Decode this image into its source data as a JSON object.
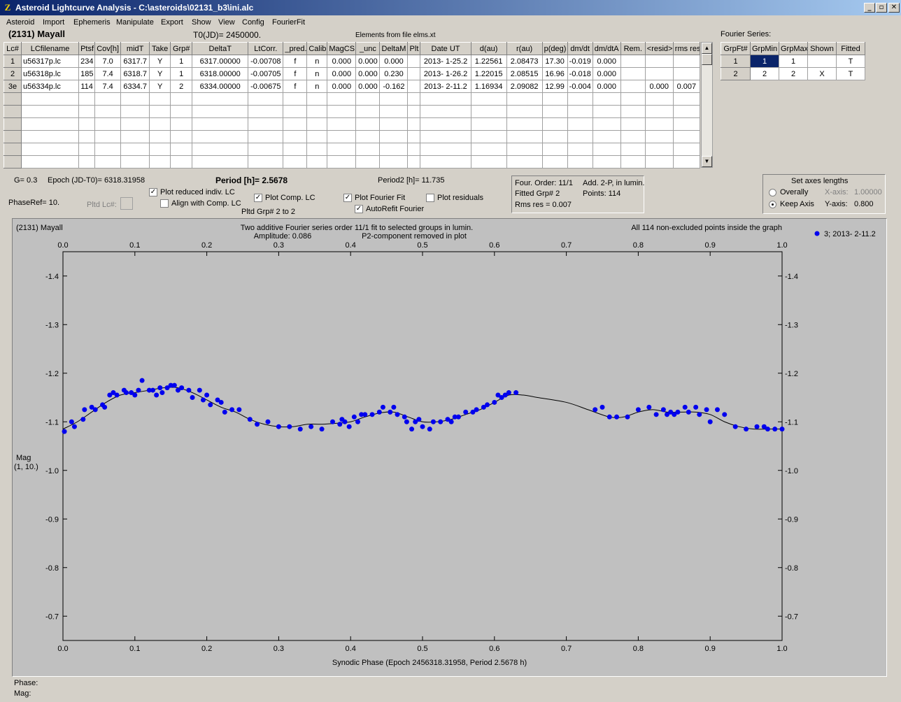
{
  "window": {
    "title": "Asteroid Lightcurve Analysis - C:\\asteroids\\02131_b3\\ini.alc",
    "min": "_",
    "max": "▫",
    "close": "✕"
  },
  "menu": [
    "Asteroid",
    "Import",
    "Ephemeris",
    "Manipulate",
    "Export",
    "Show",
    "View",
    "Config",
    "FourierFit"
  ],
  "header": {
    "asteroid": "(2131) Mayall",
    "t0": "T0(JD)= 2450000.",
    "elements": "Elements from file elms.xt"
  },
  "lc_table": {
    "columns": [
      "Lc#",
      "LCfilename",
      "Ptsf",
      "Cov[h]",
      "midT",
      "Take",
      "Grp#",
      "DeltaT",
      "LtCorr.",
      "_pred.",
      "Calib.",
      "MagCS",
      "_unc",
      "DeltaM",
      "Plt",
      "Date UT",
      "d(au)",
      "r(au)",
      "p(deg)",
      "dm/dt",
      "dm/dtA",
      "Rem.",
      "<resid>",
      "rms res"
    ],
    "rows": [
      [
        "1",
        "u56317p.lc",
        "234",
        "7.0",
        "6317.7",
        "Y",
        "1",
        "6317.00000",
        "-0.00708",
        "f",
        "n",
        "0.000",
        "0.000",
        "0.000",
        "",
        "2013- 1-25.2",
        "1.22561",
        "2.08473",
        "17.30",
        "-0.019",
        "0.000",
        "",
        "",
        ""
      ],
      [
        "2",
        "u56318p.lc",
        "185",
        "7.4",
        "6318.7",
        "Y",
        "1",
        "6318.00000",
        "-0.00705",
        "f",
        "n",
        "0.000",
        "0.000",
        "0.230",
        "",
        "2013- 1-26.2",
        "1.22015",
        "2.08515",
        "16.96",
        "-0.018",
        "0.000",
        "",
        "",
        ""
      ],
      [
        "3e",
        "u56334p.lc",
        "114",
        "7.4",
        "6334.7",
        "Y",
        "2",
        "6334.00000",
        "-0.00675",
        "f",
        "n",
        "0.000",
        "0.000",
        "-0.162",
        "",
        "2013- 2-11.2",
        "1.16934",
        "2.09082",
        "12.99",
        "-0.004",
        "0.000",
        "",
        "0.000",
        "0.007"
      ]
    ]
  },
  "fourier_series": {
    "label": "Fourier Series:",
    "columns": [
      "GrpFt#",
      "GrpMin",
      "GrpMax",
      "Shown",
      "Fitted"
    ],
    "rows": [
      [
        "1",
        "1",
        "1",
        "",
        "T"
      ],
      [
        "2",
        "2",
        "2",
        "X",
        "T"
      ]
    ]
  },
  "params": {
    "g": "G= 0.3",
    "epoch": "Epoch (JD-T0)= 6318.31958",
    "period": "Period [h]= 2.5678",
    "period2": "Period2 [h]= 11.735",
    "phaseref": "PhaseRef= 10.",
    "pltd_lc": "Pltd Lc#:",
    "pltd_grp": "Pltd Grp#  2   to   2"
  },
  "checks": {
    "plot_reduced": "Plot reduced indiv. LC",
    "align_comp": "Align with Comp. LC",
    "plot_comp": "Plot Comp. LC",
    "plot_fourier": "Plot Fourier Fit",
    "autorefit": "AutoRefit Fourier",
    "plot_residuals": "Plot residuals",
    "check": "✓"
  },
  "fourier_info": {
    "order": "Four. Order: 11/1",
    "add": "Add. 2-P, in lumin.",
    "fitted": "Fitted Grp# 2",
    "points": "Points: 114",
    "rms": "Rms res    = 0.007"
  },
  "axes_box": {
    "title": "Set axes lengths",
    "overally": "Overally",
    "keep": "Keep Axis",
    "xaxis": "X-axis:",
    "xval": "1.00000",
    "yaxis": "Y-axis:",
    "yval": "0.800"
  },
  "status": {
    "phase": "Phase:",
    "mag": "Mag:"
  },
  "chart_data": {
    "type": "scatter",
    "object": "(2131) Mayall",
    "title": "Two additive Fourier series order 11/1 fit to selected groups in lumin.",
    "subtitle": "Amplitude: 0.086",
    "note": "P2-component removed in plot",
    "info": "All 114 non-excluded points inside the graph",
    "legend": "3; 2013- 2-11.2",
    "xlabel": "Synodic Phase (Epoch 2456318.31958, Period 2.5678 h)",
    "ylabel": [
      "Mag",
      "(1, 10.)"
    ],
    "xlim": [
      0,
      1
    ],
    "ylim": [
      -0.65,
      -1.45
    ],
    "xticks": [
      "0.0",
      "0.1",
      "0.2",
      "0.3",
      "0.4",
      "0.5",
      "0.6",
      "0.7",
      "0.8",
      "0.9",
      "1.0"
    ],
    "yticks": [
      "-1.4",
      "-1.3",
      "-1.2",
      "-1.1",
      "-1.0",
      "-0.9",
      "-0.8",
      "-0.7"
    ],
    "point_color": "#0000ee",
    "points": [
      [
        0.002,
        -1.08
      ],
      [
        0.012,
        -1.1
      ],
      [
        0.016,
        -1.09
      ],
      [
        0.028,
        -1.105
      ],
      [
        0.03,
        -1.125
      ],
      [
        0.04,
        -1.13
      ],
      [
        0.045,
        -1.125
      ],
      [
        0.055,
        -1.135
      ],
      [
        0.058,
        -1.13
      ],
      [
        0.065,
        -1.155
      ],
      [
        0.07,
        -1.16
      ],
      [
        0.075,
        -1.155
      ],
      [
        0.085,
        -1.165
      ],
      [
        0.088,
        -1.16
      ],
      [
        0.095,
        -1.16
      ],
      [
        0.1,
        -1.155
      ],
      [
        0.105,
        -1.165
      ],
      [
        0.11,
        -1.185
      ],
      [
        0.12,
        -1.165
      ],
      [
        0.125,
        -1.165
      ],
      [
        0.13,
        -1.155
      ],
      [
        0.135,
        -1.17
      ],
      [
        0.138,
        -1.16
      ],
      [
        0.145,
        -1.17
      ],
      [
        0.15,
        -1.175
      ],
      [
        0.155,
        -1.175
      ],
      [
        0.16,
        -1.165
      ],
      [
        0.165,
        -1.17
      ],
      [
        0.175,
        -1.165
      ],
      [
        0.18,
        -1.15
      ],
      [
        0.19,
        -1.165
      ],
      [
        0.195,
        -1.145
      ],
      [
        0.2,
        -1.155
      ],
      [
        0.205,
        -1.135
      ],
      [
        0.215,
        -1.145
      ],
      [
        0.22,
        -1.14
      ],
      [
        0.225,
        -1.12
      ],
      [
        0.235,
        -1.125
      ],
      [
        0.245,
        -1.125
      ],
      [
        0.26,
        -1.105
      ],
      [
        0.27,
        -1.095
      ],
      [
        0.285,
        -1.1
      ],
      [
        0.3,
        -1.09
      ],
      [
        0.315,
        -1.09
      ],
      [
        0.33,
        -1.085
      ],
      [
        0.345,
        -1.09
      ],
      [
        0.36,
        -1.085
      ],
      [
        0.375,
        -1.1
      ],
      [
        0.385,
        -1.095
      ],
      [
        0.388,
        -1.105
      ],
      [
        0.392,
        -1.1
      ],
      [
        0.398,
        -1.09
      ],
      [
        0.405,
        -1.11
      ],
      [
        0.41,
        -1.1
      ],
      [
        0.415,
        -1.115
      ],
      [
        0.42,
        -1.115
      ],
      [
        0.43,
        -1.115
      ],
      [
        0.44,
        -1.12
      ],
      [
        0.445,
        -1.13
      ],
      [
        0.455,
        -1.12
      ],
      [
        0.46,
        -1.13
      ],
      [
        0.465,
        -1.115
      ],
      [
        0.475,
        -1.11
      ],
      [
        0.478,
        -1.1
      ],
      [
        0.485,
        -1.085
      ],
      [
        0.49,
        -1.1
      ],
      [
        0.495,
        -1.105
      ],
      [
        0.5,
        -1.09
      ],
      [
        0.51,
        -1.085
      ],
      [
        0.515,
        -1.1
      ],
      [
        0.525,
        -1.1
      ],
      [
        0.535,
        -1.105
      ],
      [
        0.54,
        -1.1
      ],
      [
        0.545,
        -1.11
      ],
      [
        0.55,
        -1.11
      ],
      [
        0.56,
        -1.12
      ],
      [
        0.57,
        -1.12
      ],
      [
        0.575,
        -1.125
      ],
      [
        0.585,
        -1.13
      ],
      [
        0.59,
        -1.135
      ],
      [
        0.6,
        -1.14
      ],
      [
        0.605,
        -1.155
      ],
      [
        0.61,
        -1.15
      ],
      [
        0.615,
        -1.155
      ],
      [
        0.62,
        -1.16
      ],
      [
        0.63,
        -1.16
      ],
      [
        0.74,
        -1.125
      ],
      [
        0.75,
        -1.13
      ],
      [
        0.76,
        -1.11
      ],
      [
        0.77,
        -1.11
      ],
      [
        0.785,
        -1.11
      ],
      [
        0.8,
        -1.125
      ],
      [
        0.815,
        -1.13
      ],
      [
        0.825,
        -1.115
      ],
      [
        0.835,
        -1.125
      ],
      [
        0.84,
        -1.115
      ],
      [
        0.845,
        -1.12
      ],
      [
        0.85,
        -1.115
      ],
      [
        0.855,
        -1.12
      ],
      [
        0.865,
        -1.13
      ],
      [
        0.87,
        -1.12
      ],
      [
        0.88,
        -1.13
      ],
      [
        0.885,
        -1.115
      ],
      [
        0.895,
        -1.125
      ],
      [
        0.9,
        -1.1
      ],
      [
        0.91,
        -1.125
      ],
      [
        0.92,
        -1.115
      ],
      [
        0.935,
        -1.09
      ],
      [
        0.95,
        -1.085
      ],
      [
        0.965,
        -1.09
      ],
      [
        0.975,
        -1.09
      ],
      [
        0.98,
        -1.085
      ],
      [
        0.99,
        -1.085
      ],
      [
        1.0,
        -1.085
      ]
    ],
    "fit": [
      [
        0.0,
        -1.085
      ],
      [
        0.02,
        -1.1
      ],
      [
        0.04,
        -1.12
      ],
      [
        0.06,
        -1.14
      ],
      [
        0.08,
        -1.155
      ],
      [
        0.1,
        -1.16
      ],
      [
        0.12,
        -1.165
      ],
      [
        0.14,
        -1.17
      ],
      [
        0.16,
        -1.17
      ],
      [
        0.18,
        -1.16
      ],
      [
        0.2,
        -1.145
      ],
      [
        0.22,
        -1.13
      ],
      [
        0.24,
        -1.12
      ],
      [
        0.26,
        -1.105
      ],
      [
        0.28,
        -1.095
      ],
      [
        0.3,
        -1.09
      ],
      [
        0.32,
        -1.09
      ],
      [
        0.34,
        -1.095
      ],
      [
        0.36,
        -1.095
      ],
      [
        0.38,
        -1.097
      ],
      [
        0.4,
        -1.1
      ],
      [
        0.42,
        -1.11
      ],
      [
        0.44,
        -1.118
      ],
      [
        0.46,
        -1.12
      ],
      [
        0.48,
        -1.11
      ],
      [
        0.5,
        -1.1
      ],
      [
        0.52,
        -1.1
      ],
      [
        0.54,
        -1.105
      ],
      [
        0.56,
        -1.115
      ],
      [
        0.58,
        -1.125
      ],
      [
        0.6,
        -1.14
      ],
      [
        0.62,
        -1.155
      ],
      [
        0.64,
        -1.155
      ],
      [
        0.66,
        -1.15
      ],
      [
        0.7,
        -1.14
      ],
      [
        0.73,
        -1.125
      ],
      [
        0.76,
        -1.11
      ],
      [
        0.78,
        -1.11
      ],
      [
        0.8,
        -1.12
      ],
      [
        0.82,
        -1.125
      ],
      [
        0.84,
        -1.12
      ],
      [
        0.86,
        -1.12
      ],
      [
        0.88,
        -1.12
      ],
      [
        0.9,
        -1.115
      ],
      [
        0.92,
        -1.1
      ],
      [
        0.94,
        -1.09
      ],
      [
        0.96,
        -1.085
      ],
      [
        0.98,
        -1.085
      ],
      [
        1.0,
        -1.085
      ]
    ]
  }
}
